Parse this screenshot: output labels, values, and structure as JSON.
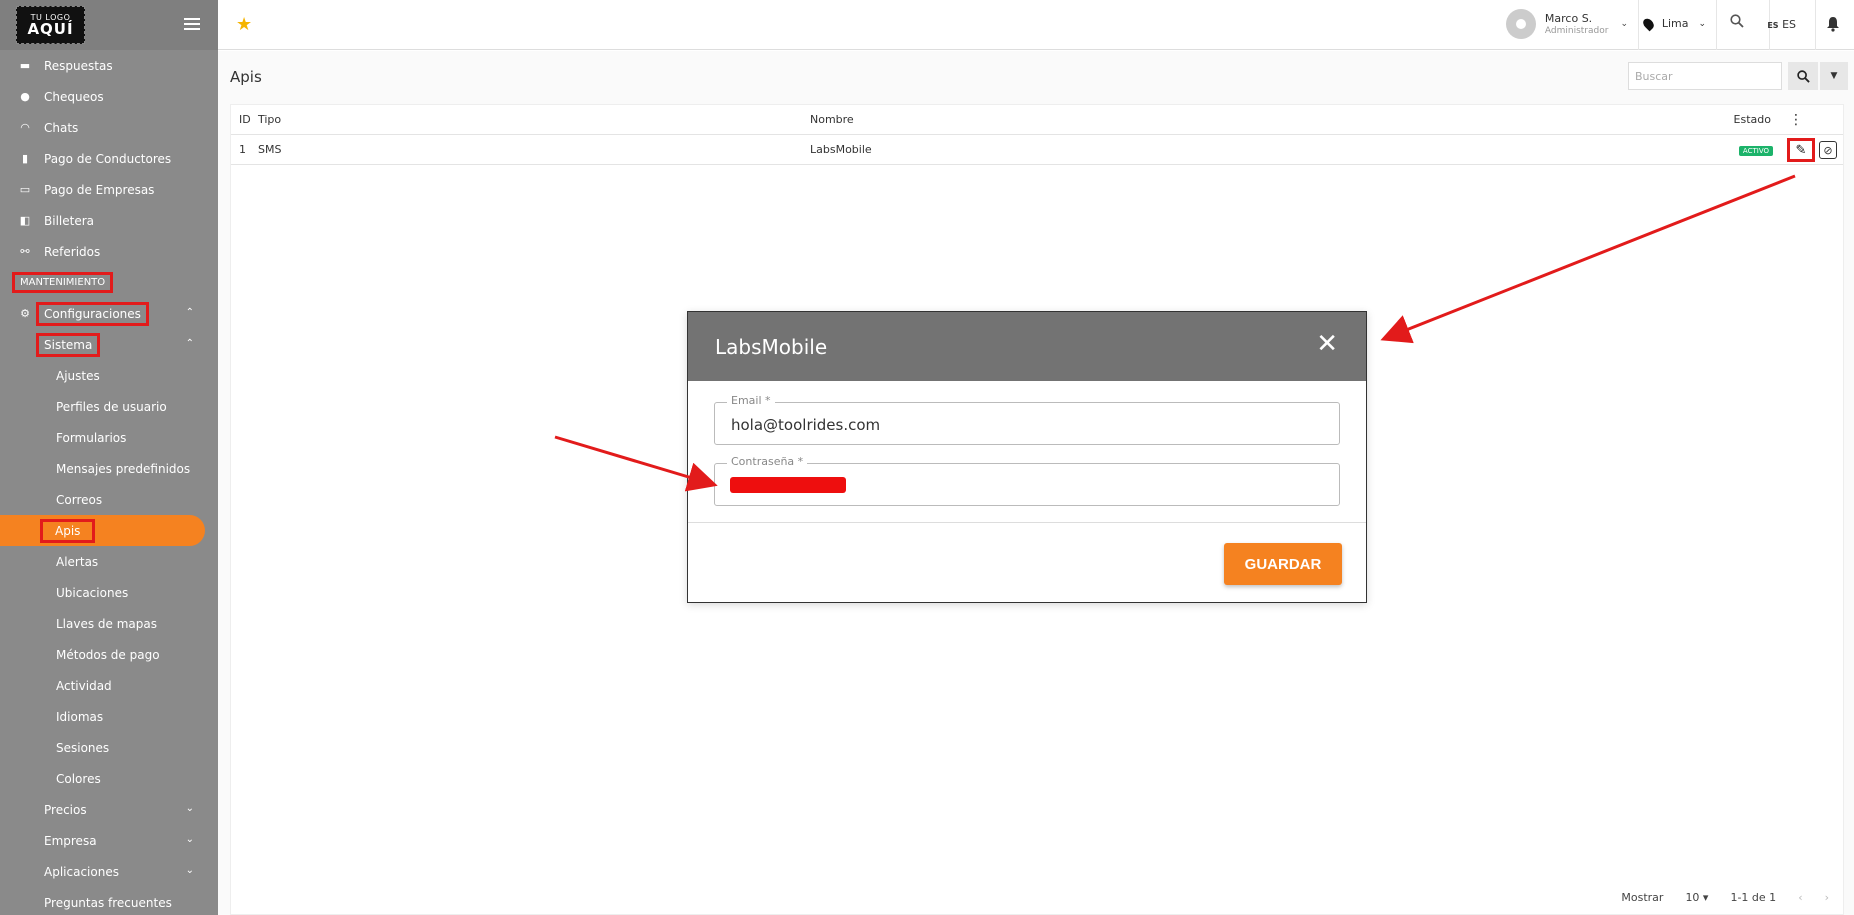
{
  "logo": {
    "line1": "TU LOGO",
    "line2": "AQUÍ"
  },
  "sidebar": {
    "items": [
      {
        "label": "Respuestas",
        "icon": "chat-lines-icon"
      },
      {
        "label": "Chequeos",
        "icon": "shield-check-icon"
      },
      {
        "label": "Chats",
        "icon": "headset-icon"
      },
      {
        "label": "Pago de Conductores",
        "icon": "clipboard-icon"
      },
      {
        "label": "Pago de Empresas",
        "icon": "card-icon"
      },
      {
        "label": "Billetera",
        "icon": "wallet-icon"
      },
      {
        "label": "Referidos",
        "icon": "referral-icon"
      }
    ],
    "section": "MANTENIMIENTO",
    "config": "Configuraciones",
    "sistema": "Sistema",
    "sistema_items": [
      "Ajustes",
      "Perfiles de usuario",
      "Formularios",
      "Mensajes predefinidos",
      "Correos",
      "Apis",
      "Alertas",
      "Ubicaciones",
      "Llaves de mapas",
      "Métodos de pago",
      "Actividad",
      "Idiomas",
      "Sesiones",
      "Colores"
    ],
    "bottom_items": [
      "Precios",
      "Empresa",
      "Aplicaciones",
      "Preguntas frecuentes"
    ]
  },
  "topbar": {
    "user_name": "Marco S.",
    "user_role": "Administrador",
    "city": "Lima",
    "lang_code": "ES",
    "lang_flag": "ES"
  },
  "page": {
    "title": "Apis",
    "search_placeholder": "Buscar"
  },
  "table": {
    "headers": {
      "id": "ID",
      "tipo": "Tipo",
      "nombre": "Nombre",
      "estado": "Estado"
    },
    "rows": [
      {
        "id": "1",
        "tipo": "SMS",
        "nombre": "LabsMobile",
        "estado": "ACTIVO"
      }
    ]
  },
  "footer": {
    "mostrar": "Mostrar",
    "per_page": "10",
    "range": "1-1 de 1"
  },
  "modal": {
    "title": "LabsMobile",
    "email_label": "Email *",
    "email_value": "hola@toolrides.com",
    "password_label": "Contraseña *",
    "save_label": "GUARDAR"
  },
  "colors": {
    "accent": "#f58220",
    "sidebar": "#8a8a8a",
    "highlight": "#e21b1b",
    "badge": "#1cb36a"
  }
}
